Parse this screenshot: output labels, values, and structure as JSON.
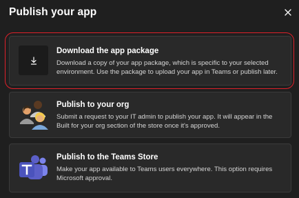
{
  "dialog": {
    "title": "Publish your app",
    "close_icon": "close-icon"
  },
  "options": [
    {
      "title": "Download the app package",
      "description": "Download a copy of your app package, which is specific to your selected environment. Use the package to upload your app in Teams or publish later.",
      "icon": "download-icon",
      "highlighted": true
    },
    {
      "title": "Publish to your org",
      "description": "Submit a request to your IT admin to publish your app. It will appear in the Built for your org section of the store once it's approved.",
      "icon": "people-icon"
    },
    {
      "title": "Publish to the Teams Store",
      "description": "Make your app available to Teams users everywhere. This option requires Microsoft approval.",
      "icon": "teams-logo-icon"
    }
  ],
  "colors": {
    "background": "#1f1f1f",
    "card": "#292929",
    "highlight": "#e0202a",
    "teams_purple": "#5b5fc7"
  }
}
